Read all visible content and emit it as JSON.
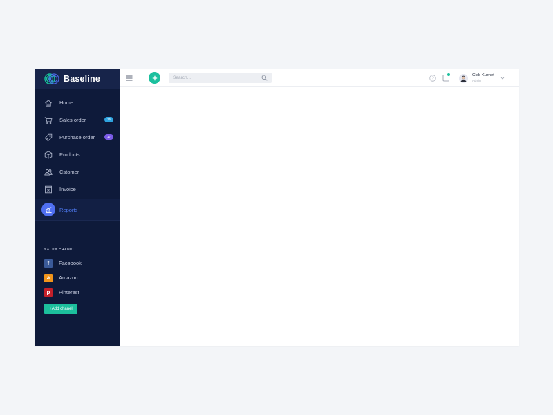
{
  "brand": {
    "name": "Baseline"
  },
  "nav": [
    {
      "label": "Home",
      "icon": "home-icon"
    },
    {
      "label": "Sales order",
      "icon": "cart-icon",
      "badge": "15",
      "badge_color": "#2fa4e0"
    },
    {
      "label": "Purchase order",
      "icon": "tag-icon",
      "badge": "17",
      "badge_color": "#7a5be6"
    },
    {
      "label": "Products",
      "icon": "box-icon"
    },
    {
      "label": "Cstomer",
      "icon": "users-icon"
    },
    {
      "label": "Invoice",
      "icon": "invoice-icon"
    },
    {
      "label": "Reports",
      "icon": "chart-icon",
      "active": true
    }
  ],
  "sales_channel": {
    "title": "SALES CHANEL",
    "items": [
      {
        "label": "Facebook",
        "icon": "facebook-icon",
        "glyph": "f",
        "color": "#3a5a99"
      },
      {
        "label": "Amazon",
        "icon": "amazon-icon",
        "glyph": "a",
        "color": "#f0941b"
      },
      {
        "label": "Pinterest",
        "icon": "pinterest-icon",
        "glyph": "p",
        "color": "#c4202a"
      }
    ],
    "add_label": "+Add chanel"
  },
  "search": {
    "placeholder": "Search..."
  },
  "user": {
    "name": "Gleb Kuznet",
    "role": "Admin"
  },
  "colors": {
    "sidebar": "#0e1a3a",
    "accent": "#1cc09e",
    "active": "#4f6ff2"
  }
}
